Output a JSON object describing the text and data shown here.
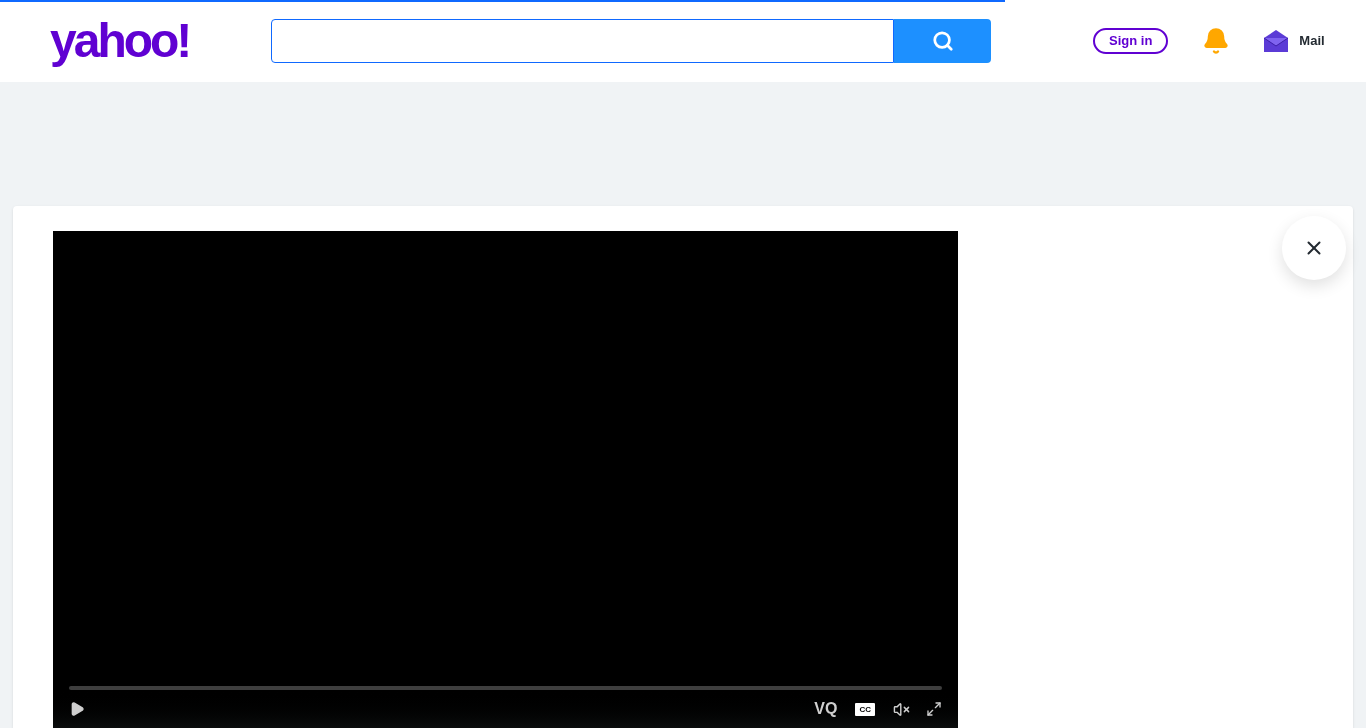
{
  "header": {
    "logo": "yahoo!",
    "sign_in": "Sign in",
    "mail": "Mail"
  },
  "video": {
    "controls": {
      "quality": "VQ",
      "captions": "CC"
    }
  }
}
